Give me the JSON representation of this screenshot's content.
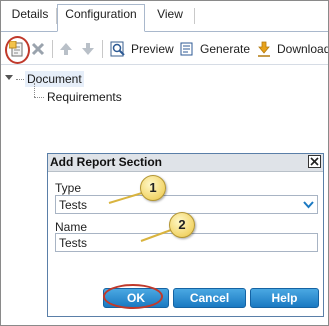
{
  "tabs": [
    {
      "label": "Details",
      "active": false
    },
    {
      "label": "Configuration",
      "active": true
    },
    {
      "label": "View",
      "active": false
    }
  ],
  "toolbar": {
    "add_section_icon": "add-report-section-icon",
    "delete_icon": "delete-icon",
    "move_up_icon": "arrow-up-icon",
    "move_down_icon": "arrow-down-icon",
    "preview_label": "Preview",
    "generate_label": "Generate",
    "download_label": "Download ."
  },
  "tree": {
    "root": "Document",
    "child": "Requirements"
  },
  "dialog": {
    "title": "Add Report Section",
    "type_label": "Type",
    "type_value": "Tests",
    "name_label": "Name",
    "name_value": "Tests",
    "ok_label": "OK",
    "cancel_label": "Cancel",
    "help_label": "Help"
  },
  "callouts": [
    "1",
    "2"
  ],
  "colors": {
    "accent_button": "#1a79c2",
    "highlight_ring": "#c0392b",
    "callout_fill": "#f2d56a",
    "selected_node": "#e6eef9"
  }
}
